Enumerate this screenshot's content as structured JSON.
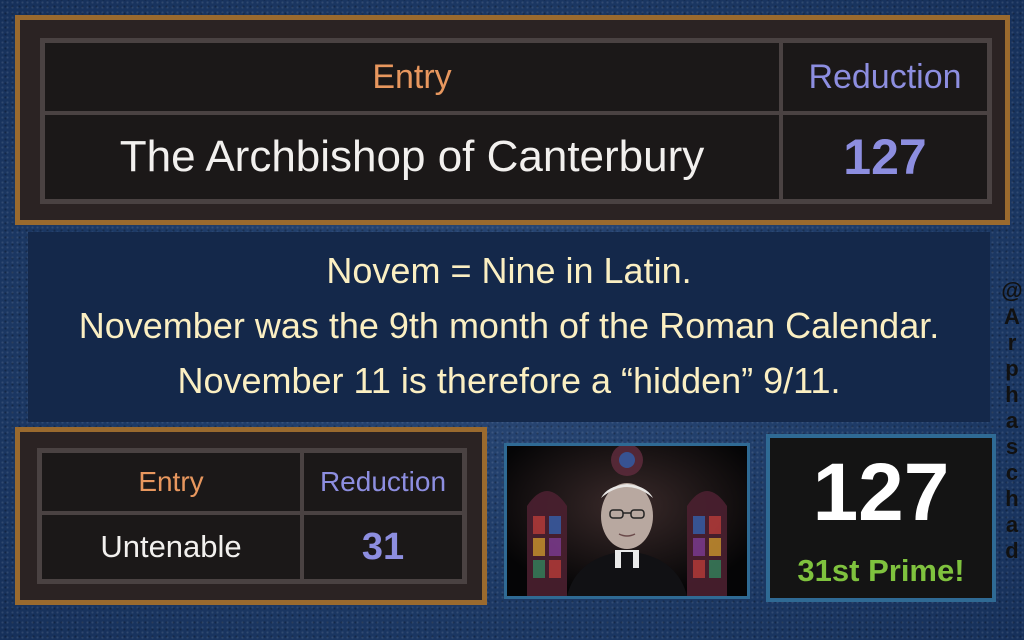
{
  "top_table": {
    "header_entry": "Entry",
    "header_reduction": "Reduction",
    "entry": "The Archbishop of Canterbury",
    "reduction": "127"
  },
  "middle_text": {
    "line1": "Novem = Nine in Latin.",
    "line2": "November was the 9th month of the Roman Calendar.",
    "line3": "November 11 is therefore a “hidden” 9/11."
  },
  "bottom_table": {
    "header_entry": "Entry",
    "header_reduction": "Reduction",
    "entry": "Untenable",
    "reduction": "31"
  },
  "prime_box": {
    "number": "127",
    "caption": "31st Prime!"
  },
  "photo": {
    "icon": "archbishop-portrait"
  },
  "watermark": {
    "handle": "@Arphaschad",
    "chars": [
      "@",
      "A",
      "r",
      "p",
      "h",
      "a",
      "s",
      "c",
      "h",
      "a",
      "d"
    ]
  },
  "colors": {
    "frame": "#9a6a2e",
    "entry_header": "#e8975e",
    "reduction": "#8d8ee0",
    "caption_text": "#fbefc2",
    "prime_green": "#7fc23e",
    "background": "#1d3a66"
  }
}
